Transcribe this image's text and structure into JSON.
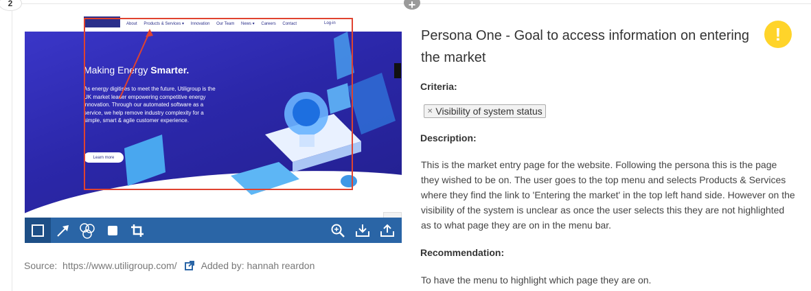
{
  "entry": {
    "number": "2",
    "add_symbol": "+"
  },
  "screenshot": {
    "nav": {
      "items": [
        "About",
        "Products & Services ▾",
        "Innovation",
        "Our Team",
        "News ▾",
        "Careers",
        "Contact"
      ],
      "login": "Log-in"
    },
    "hero": {
      "title_prefix": "Making Energy ",
      "title_bold": "Smarter.",
      "body": "As energy digitises to meet the future, Utiligroup is the UK market leader empowering competitive energy innovation. Through our automated software as a service, we help remove industry complexity for a simple, smart & agile customer experience.",
      "button": "Learn more"
    },
    "annotation_color": "#e0432f"
  },
  "toolbar": {
    "tools": [
      "rectangle-tool",
      "arrow-tool",
      "number-tool",
      "fill-tool",
      "crop-tool"
    ],
    "actions": [
      "zoom-in",
      "download",
      "upload"
    ]
  },
  "source": {
    "label": "Source:",
    "url": "https://www.utiligroup.com/",
    "added_by": "Added by: hannah reardon"
  },
  "issue": {
    "title": "Persona One - Goal to access information on entering the market",
    "severity_icon": "warning-icon",
    "severity_color": "#ffd42a",
    "criteria_label": "Criteria:",
    "criteria_tag": "Visibility of system status",
    "description_label": "Description:",
    "description": "This is the market entry page for the website. Following the persona this is the page they wished to be on. The user goes to the top menu and selects Products & Services where they find the link to 'Entering the market' in the top left hand side. However on the visibility of the system is unclear as once the user selects this they are not highlighted as to what page they are on in the menu bar.",
    "recommendation_label": "Recommendation:",
    "recommendation": "To have the menu to highlight which page they are on."
  }
}
